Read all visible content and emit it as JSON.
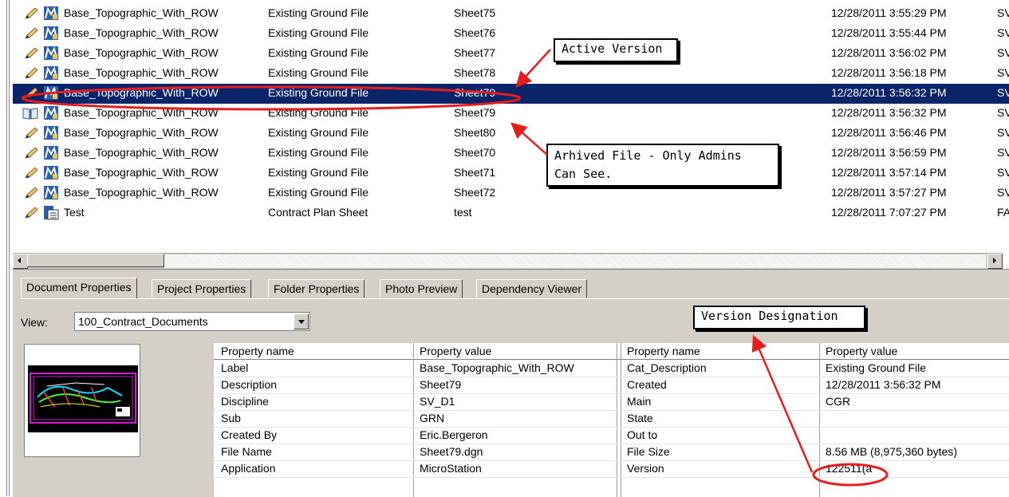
{
  "file_list": {
    "rows": [
      {
        "icon": "pencil-icon",
        "name": "Base_Topographic_With_ROW",
        "type": "Existing Ground File",
        "title": "Sheet75",
        "date": "12/28/2011 3:55:29 PM",
        "tail": "SV"
      },
      {
        "icon": "pencil-icon",
        "name": "Base_Topographic_With_ROW",
        "type": "Existing Ground File",
        "title": "Sheet76",
        "date": "12/28/2011 3:55:44 PM",
        "tail": "SV"
      },
      {
        "icon": "pencil-icon",
        "name": "Base_Topographic_With_ROW",
        "type": "Existing Ground File",
        "title": "Sheet77",
        "date": "12/28/2011 3:56:02 PM",
        "tail": "SV"
      },
      {
        "icon": "pencil-icon",
        "name": "Base_Topographic_With_ROW",
        "type": "Existing Ground File",
        "title": "Sheet78",
        "date": "12/28/2011 3:56:18 PM",
        "tail": "SV"
      },
      {
        "icon": "pencil-icon",
        "name": "Base_Topographic_With_ROW",
        "type": "Existing Ground File",
        "title": "Sheet79",
        "date": "12/28/2011 3:56:32 PM",
        "tail": "SV",
        "selected": true
      },
      {
        "icon": "book-icon",
        "name": "Base_Topographic_With_ROW",
        "type": "Existing Ground File",
        "title": "Sheet79",
        "date": "12/28/2011 3:56:32 PM",
        "tail": "SV"
      },
      {
        "icon": "pencil-icon",
        "name": "Base_Topographic_With_ROW",
        "type": "Existing Ground File",
        "title": "Sheet80",
        "date": "12/28/2011 3:56:46 PM",
        "tail": "SV"
      },
      {
        "icon": "pencil-icon",
        "name": "Base_Topographic_With_ROW",
        "type": "Existing Ground File",
        "title": "Sheet70",
        "date": "12/28/2011 3:56:59 PM",
        "tail": "SV"
      },
      {
        "icon": "pencil-icon",
        "name": "Base_Topographic_With_ROW",
        "type": "Existing Ground File",
        "title": "Sheet71",
        "date": "12/28/2011 3:57:14 PM",
        "tail": "SV"
      },
      {
        "icon": "pencil-icon",
        "name": "Base_Topographic_With_ROW",
        "type": "Existing Ground File",
        "title": "Sheet72",
        "date": "12/28/2011 3:57:27 PM",
        "tail": "SV"
      },
      {
        "icon": "pencil-icon",
        "name": "Test",
        "type": "Contract Plan Sheet",
        "title": "test",
        "date": "12/28/2011 7:07:27 PM",
        "tail": "FA"
      }
    ]
  },
  "tabs": [
    "Document Properties",
    "Project Properties",
    "Folder Properties",
    "Photo Preview",
    "Dependency Viewer"
  ],
  "view": {
    "label": "View:",
    "value": "100_Contract_Documents"
  },
  "properties": {
    "headers": [
      "Property name",
      "Property value",
      "Property name",
      "Property value"
    ],
    "rows": [
      [
        "Label",
        "Base_Topographic_With_ROW",
        "Cat_Description",
        "Existing Ground File"
      ],
      [
        "Description",
        "Sheet79",
        "Created",
        "12/28/2011 3:56:32 PM"
      ],
      [
        "Discipline",
        "SV_D1",
        "Main",
        "CGR"
      ],
      [
        "Sub",
        "GRN",
        "State",
        ""
      ],
      [
        "Created By",
        "Eric.Bergeron",
        "Out to",
        ""
      ],
      [
        "File Name",
        "Sheet79.dgn",
        "File Size",
        "8.56 MB (8,975,360 bytes)"
      ],
      [
        "Application",
        "MicroStation",
        "Version",
        "122511(a"
      ]
    ]
  },
  "callouts": {
    "active": "Active Version",
    "archived_line1": "Arhived File - Only Admins",
    "archived_line2": "Can See.",
    "version": "Version Designation"
  },
  "colors": {
    "selection": "#0a246a",
    "annotation": "#e81c1c",
    "panel": "#d4d0c8"
  }
}
